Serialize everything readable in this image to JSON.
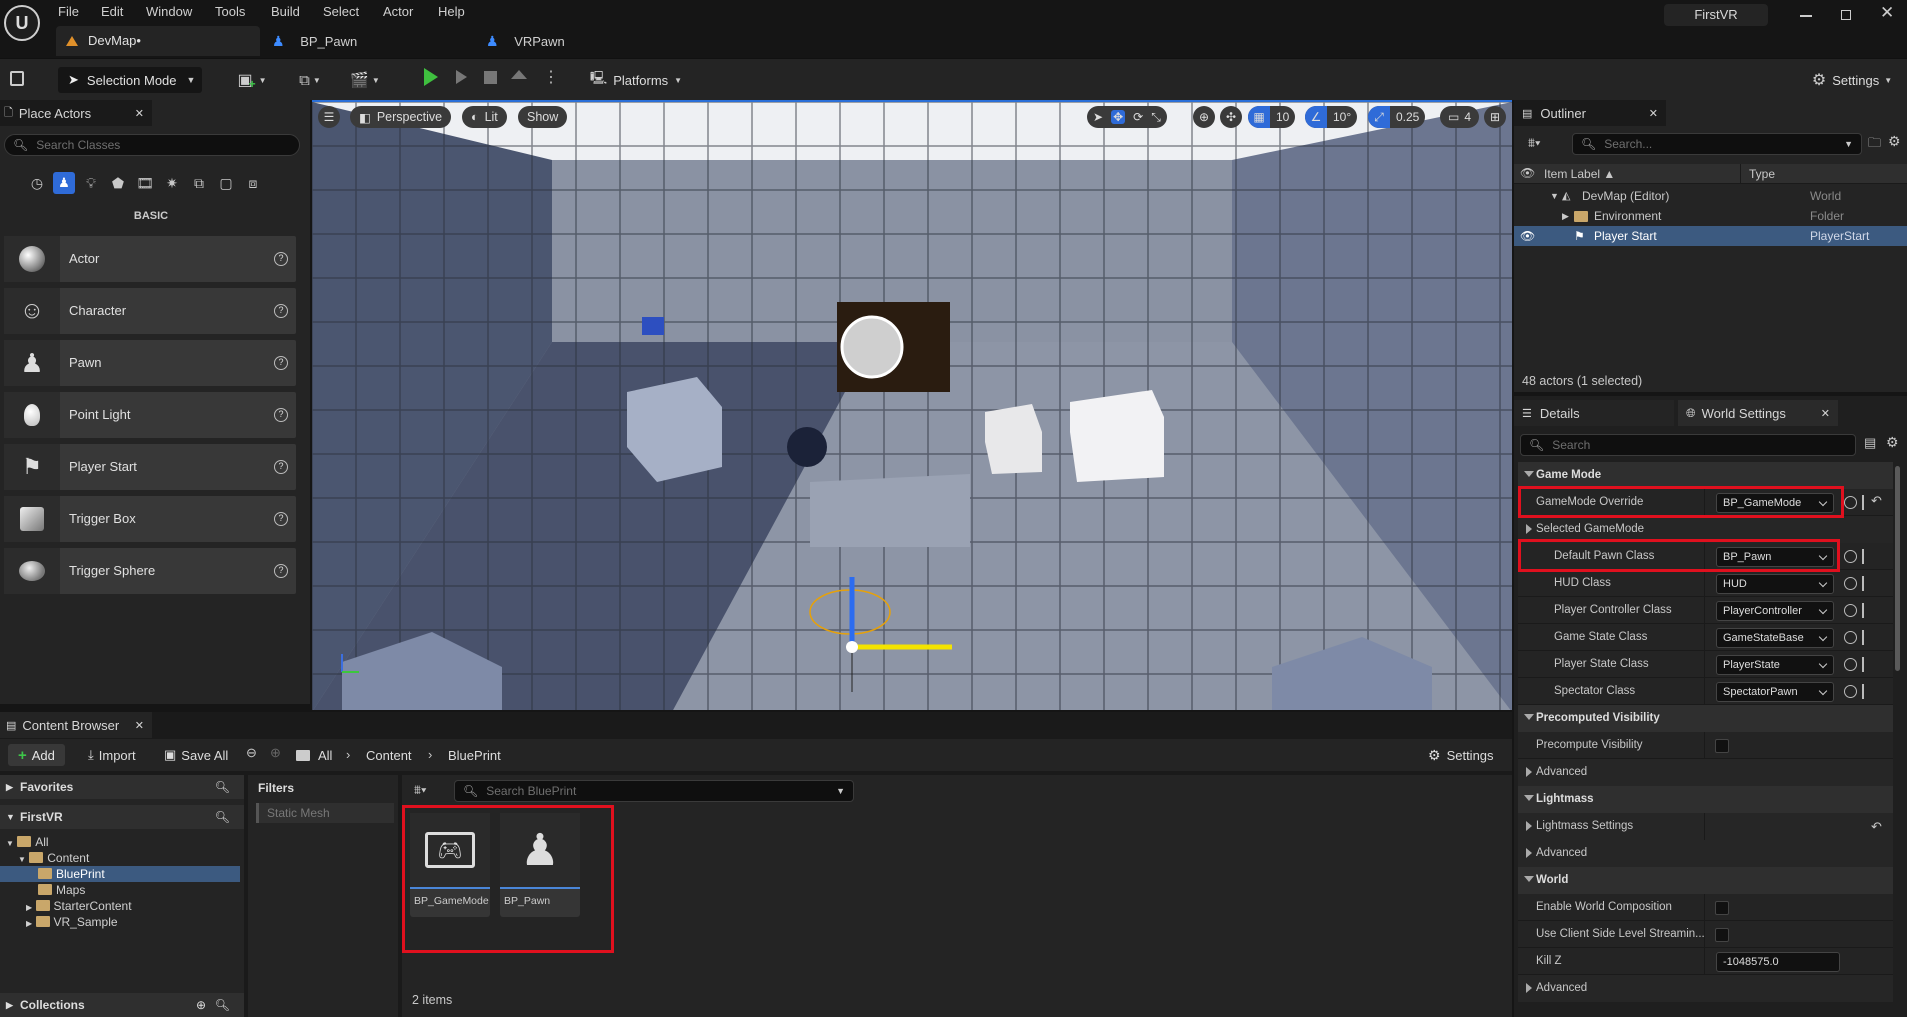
{
  "app": {
    "window_title": "FirstVR"
  },
  "menu": [
    "File",
    "Edit",
    "Window",
    "Tools",
    "Build",
    "Select",
    "Actor",
    "Help"
  ],
  "doc_tabs": [
    {
      "label": "DevMap•"
    },
    {
      "label": "BP_Pawn"
    },
    {
      "label": "VRPawn"
    }
  ],
  "toolbar": {
    "selection_mode": "Selection Mode",
    "platforms": "Platforms",
    "settings": "Settings"
  },
  "place_actors": {
    "title": "Place Actors",
    "search_placeholder": "Search Classes",
    "category": "BASIC",
    "items": [
      {
        "label": "Actor",
        "icon": "sphere-icon"
      },
      {
        "label": "Character",
        "icon": "mannequin-icon"
      },
      {
        "label": "Pawn",
        "icon": "pawn-icon"
      },
      {
        "label": "Point Light",
        "icon": "bulb-icon"
      },
      {
        "label": "Player Start",
        "icon": "flag-gamepad-icon"
      },
      {
        "label": "Trigger Box",
        "icon": "cube-icon"
      },
      {
        "label": "Trigger Sphere",
        "icon": "sphere-icon"
      }
    ]
  },
  "viewport": {
    "perspective": "Perspective",
    "lit": "Lit",
    "show": "Show",
    "grid": "10",
    "angle": "10°",
    "scale": "0.25",
    "cam_speed": "4"
  },
  "outliner": {
    "title": "Outliner",
    "search_placeholder": "Search...",
    "col_label": "Item Label",
    "col_type": "Type",
    "rows": [
      {
        "label": "DevMap (Editor)",
        "type": "World"
      },
      {
        "label": "Environment",
        "type": "Folder"
      },
      {
        "label": "Player Start",
        "type": "PlayerStart"
      }
    ],
    "status": "48 actors (1 selected)"
  },
  "details": {
    "tab_details": "Details",
    "tab_world": "World Settings",
    "search_placeholder": "Search",
    "cat_game_mode": "Game Mode",
    "gamemode_override": {
      "label": "GameMode Override",
      "value": "BP_GameMode"
    },
    "selected_gamemode": "Selected GameMode",
    "props": [
      {
        "label": "Default Pawn Class",
        "value": "BP_Pawn"
      },
      {
        "label": "HUD Class",
        "value": "HUD"
      },
      {
        "label": "Player Controller Class",
        "value": "PlayerController"
      },
      {
        "label": "Game State Class",
        "value": "GameStateBase"
      },
      {
        "label": "Player State Class",
        "value": "PlayerState"
      },
      {
        "label": "Spectator Class",
        "value": "SpectatorPawn"
      }
    ],
    "cat_precomputed": "Precomputed Visibility",
    "precompute_visibility": "Precompute Visibility",
    "advanced": "Advanced",
    "cat_lightmass": "Lightmass",
    "lightmass_settings": "Lightmass Settings",
    "cat_world": "World",
    "enable_world_composition": "Enable World Composition",
    "use_client_streaming": "Use Client Side Level Streamin...",
    "kill_z": {
      "label": "Kill Z",
      "value": "-1048575.0"
    }
  },
  "content_browser": {
    "title": "Content Browser",
    "add": "Add",
    "import": "Import",
    "save_all": "Save All",
    "breadcrumb": [
      "All",
      "Content",
      "BluePrint"
    ],
    "settings": "Settings",
    "favorites": "Favorites",
    "project": "FirstVR",
    "tree": [
      "All",
      "Content",
      "BluePrint",
      "Maps",
      "StarterContent",
      "VR_Sample"
    ],
    "collections": "Collections",
    "filters": "Filters",
    "filter_chip": "Static Mesh",
    "search_placeholder": "Search BluePrint",
    "assets": [
      {
        "label": "BP_GameMode"
      },
      {
        "label": "BP_Pawn"
      }
    ],
    "count": "2 items"
  }
}
